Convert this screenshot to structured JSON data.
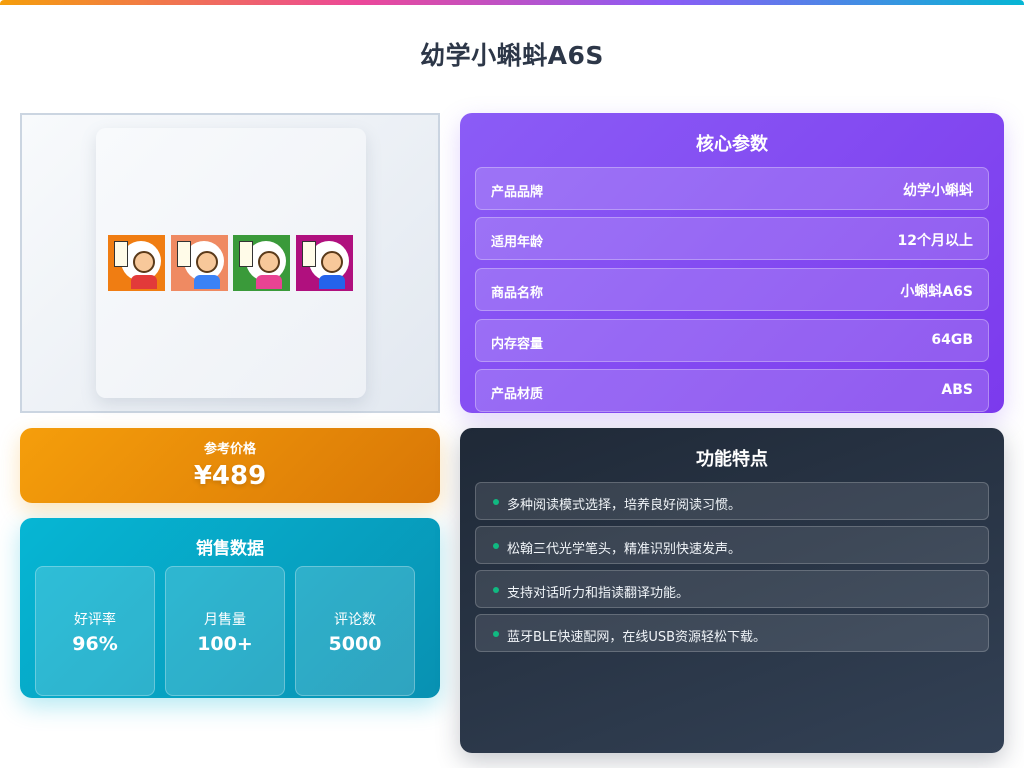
{
  "page": {
    "title": "幼学小蝌蚪A6S"
  },
  "product_image": {
    "alt": "product-image",
    "books": [
      {
        "color": "#f07d12"
      },
      {
        "color": "#ef8a62"
      },
      {
        "color": "#3a9a3a"
      },
      {
        "color": "#b0107e"
      }
    ]
  },
  "params": {
    "heading": "核心参数",
    "rows": [
      {
        "key": "产品品牌",
        "value": "幼学小蝌蚪"
      },
      {
        "key": "适用年龄",
        "value": "12个月以上"
      },
      {
        "key": "商品名称",
        "value": "小蝌蚪A6S"
      },
      {
        "key": "内存容量",
        "value": "64GB"
      },
      {
        "key": "产品材质",
        "value": "ABS"
      }
    ]
  },
  "price": {
    "label": "参考价格",
    "value": "¥489"
  },
  "sales": {
    "heading": "销售数据",
    "stats": [
      {
        "label": "好评率",
        "value": "96%"
      },
      {
        "label": "月售量",
        "value": "100+"
      },
      {
        "label": "评论数",
        "value": "5000"
      }
    ]
  },
  "features": {
    "heading": "功能特点",
    "items": [
      "多种阅读模式选择，培养良好阅读习惯。",
      "松翰三代光学笔头，精准识别快速发声。",
      "支持对话听力和指读翻译功能。",
      "蓝牙BLE快速配网，在线USB资源轻松下载。"
    ]
  },
  "colors": {
    "accent_purple": "#8b5cf6",
    "accent_orange": "#f59e0b",
    "accent_cyan": "#06b6d4",
    "dark_panel": "#1f2937",
    "bullet_green": "#10b981"
  }
}
